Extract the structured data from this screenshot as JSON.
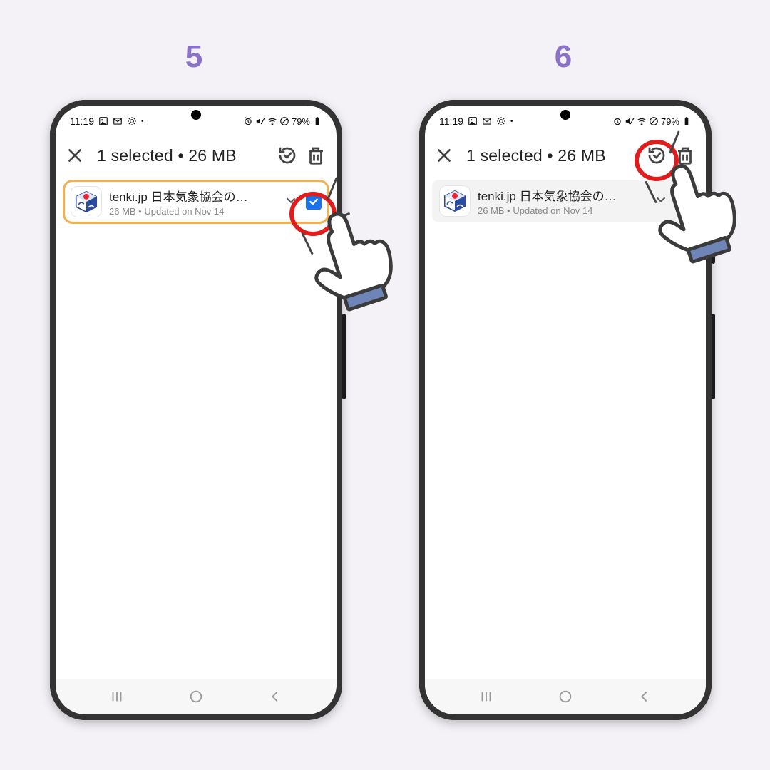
{
  "steps": {
    "left": "5",
    "right": "6"
  },
  "status": {
    "time": "11:19",
    "battery_text": "79%",
    "icons_left": [
      "image-icon",
      "gmail-icon",
      "settings-dot-icon",
      "more-dot-icon"
    ],
    "icons_right": [
      "mute-icon",
      "wifi-icon",
      "no-sim-icon",
      "battery-icon"
    ]
  },
  "actionbar": {
    "title": "1 selected  •  26 MB",
    "close": "✕",
    "update_all_icon": "update-all",
    "delete_icon": "trash"
  },
  "app_row": {
    "title": "tenki.jp 日本気象協会の…",
    "subtitle": "26 MB  •  Updated on Nov 14",
    "checkbox_checked": true
  },
  "nav": {
    "recent": "|||",
    "home": "○",
    "back": "‹"
  },
  "colors": {
    "accent_purple": "#8a72c9",
    "highlight_orange": "#f1b14e",
    "annotation_red": "#e11c1c",
    "checkbox_blue": "#1a73e8"
  }
}
